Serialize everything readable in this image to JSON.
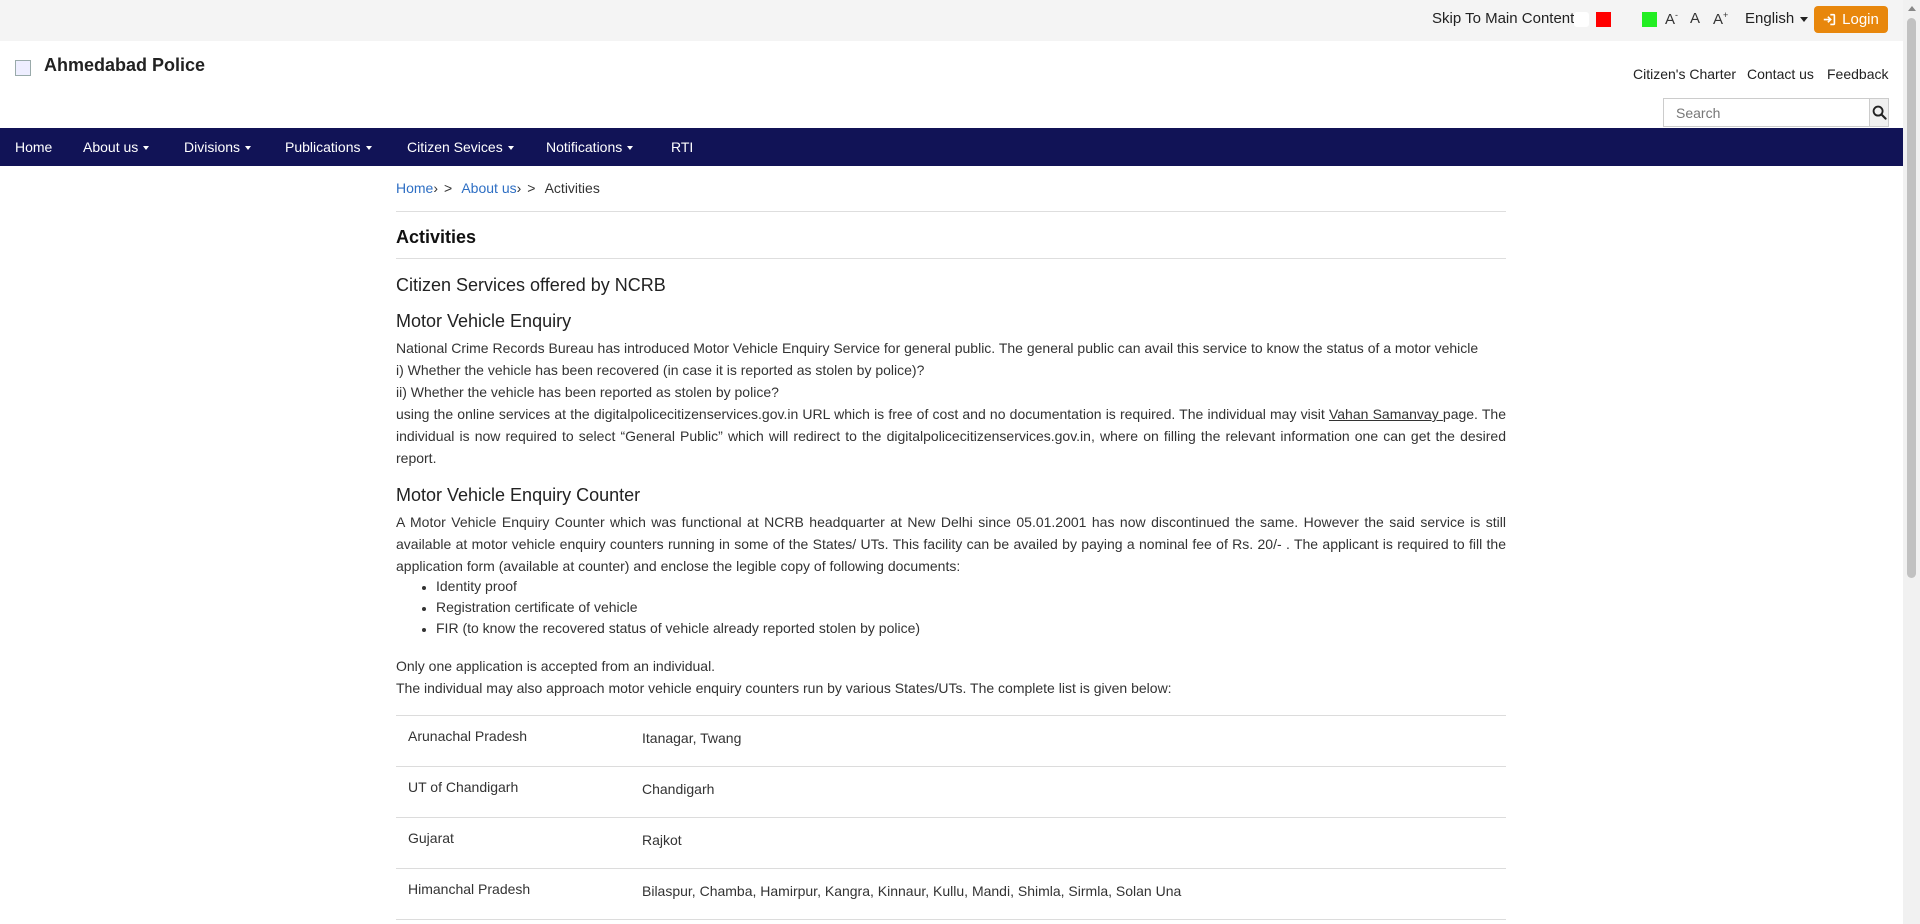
{
  "topbar": {
    "skip_link": "Skip To Main Content",
    "theme_colors": [
      "#ffffff",
      "#ff0000",
      "#22ee22"
    ],
    "font_decrease": "A",
    "font_decrease_sup": "-",
    "font_normal": "A",
    "font_increase": "A",
    "font_increase_sup": "+",
    "language": "English",
    "login_label": "Login",
    "login_color": "#e8870c"
  },
  "header": {
    "site_title": "Ahmedabad Police",
    "links": [
      "Citizen's Charter",
      "Contact us",
      "Feedback"
    ],
    "search_placeholder": "Search"
  },
  "navbar": {
    "bg_color": "#111356",
    "items": [
      {
        "label": "Home",
        "dropdown": false
      },
      {
        "label": "About us",
        "dropdown": true
      },
      {
        "label": "Divisions",
        "dropdown": true
      },
      {
        "label": "Publications",
        "dropdown": true
      },
      {
        "label": "Citizen Sevices",
        "dropdown": true
      },
      {
        "label": "Notifications",
        "dropdown": true
      },
      {
        "label": "RTI",
        "dropdown": false
      }
    ]
  },
  "breadcrumb": {
    "home": "Home",
    "about": "About us",
    "current": "Activities",
    "separator": ">"
  },
  "content": {
    "page_title": "Activities",
    "section_title": "Citizen Services offered by NCRB",
    "mve": {
      "heading": "Motor Vehicle Enquiry",
      "line1": "National Crime Records Bureau has introduced Motor Vehicle Enquiry Service for general public. The general public can avail this service to know the status of a motor vehicle",
      "line2": "i) Whether the vehicle has been recovered (in case it is reported as stolen by police)?",
      "line3": "ii) Whether the vehicle has been reported as stolen by police?",
      "para_a": "using the online services at the digitalpolicecitizenservices.gov.in URL which is free of cost and no documentation is required. The individual may visit ",
      "link_text": "Vahan Samanvay ",
      "para_b": "page.  The individual is now required to select “General Public” which will redirect to the digitalpolicecitizenservices.gov.in, where on filling the relevant information one can get the desired report."
    },
    "counter": {
      "heading": "Motor Vehicle Enquiry Counter",
      "para": "A Motor Vehicle Enquiry Counter which was functional at NCRB headquarter at New Delhi since 05.01.2001 has now discontinued the same.  However the said service is still available at motor vehicle enquiry counters running in some of the States/ UTs. This facility can be availed by paying a nominal fee of Rs. 20/- . The applicant is required to fill the application form (available at counter) and enclose the legible copy of following documents:",
      "documents": [
        "Identity proof",
        "Registration certificate of vehicle",
        "FIR (to know the recovered status of vehicle already reported stolen by police)"
      ],
      "note1": "Only one application is accepted from an individual.",
      "note2": "The individual may also approach motor vehicle enquiry counters run by various States/UTs. The complete list is given below:"
    },
    "states": [
      {
        "state": "Arunachal Pradesh",
        "cities": "Itanagar, Twang"
      },
      {
        "state": "UT of Chandigarh",
        "cities": "Chandigarh"
      },
      {
        "state": "Gujarat",
        "cities": "Rajkot"
      },
      {
        "state": "Himanchal Pradesh",
        "cities": "Bilaspur, Chamba, Hamirpur, Kangra, Kinnaur, Kullu, Mandi, Shimla, Sirmla, Solan Una"
      }
    ]
  }
}
